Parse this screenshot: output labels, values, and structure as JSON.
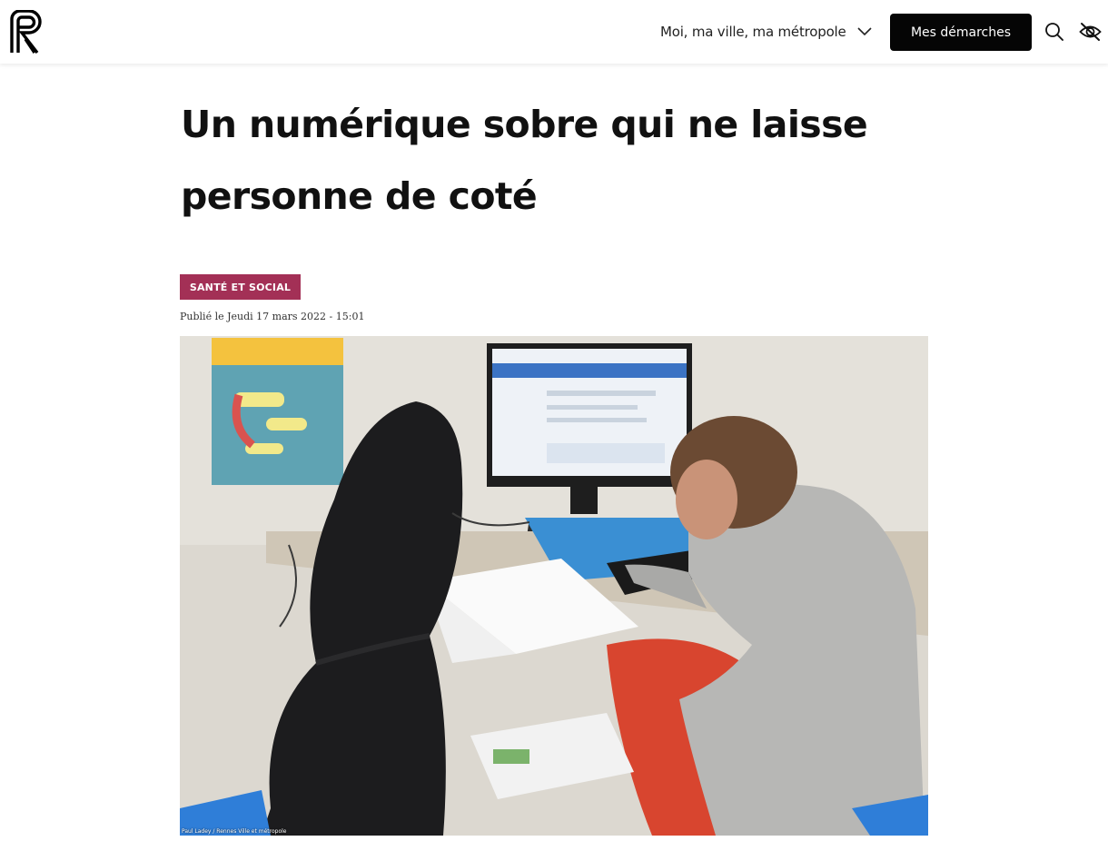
{
  "header": {
    "logo_letter": "R",
    "nav_menu_label": "Moi, ma ville, ma métropole",
    "cta_label": "Mes démarches",
    "icons": {
      "search": "search-icon",
      "accessibility": "eye-slash-icon",
      "menu_toggle": "chevron-down-icon"
    }
  },
  "article": {
    "title": "Un numérique sobre qui ne laisse personne de coté",
    "category": "SANTÉ ET SOCIAL",
    "published": "Publié le Jeudi 17 mars 2022 - 15:01",
    "photo_credit": "Paul Ladey / Rennes Ville et métropole"
  },
  "colors": {
    "category_tag": "#a33056",
    "cta_background": "#050505",
    "page_background": "#ffffff"
  }
}
